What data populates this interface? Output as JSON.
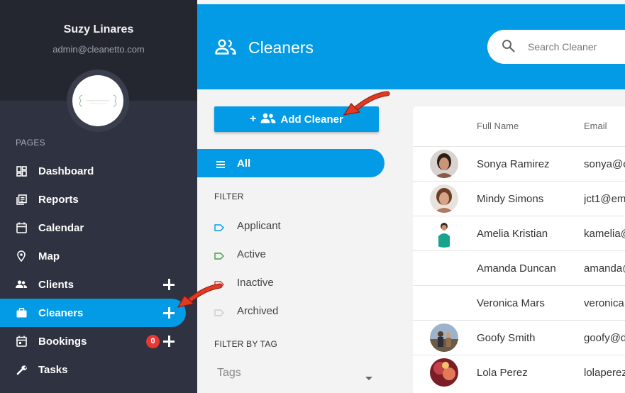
{
  "user": {
    "name": "Suzy Linares",
    "email": "admin@cleanetto.com",
    "logo_text": "Liviana Cleaning"
  },
  "sidebar": {
    "section_label": "PAGES",
    "items": [
      {
        "label": "Dashboard",
        "icon": "dashboard-icon"
      },
      {
        "label": "Reports",
        "icon": "reports-icon"
      },
      {
        "label": "Calendar",
        "icon": "calendar-icon"
      },
      {
        "label": "Map",
        "icon": "map-pin-icon"
      },
      {
        "label": "Clients",
        "icon": "people-icon"
      },
      {
        "label": "Cleaners",
        "icon": "briefcase-icon"
      },
      {
        "label": "Bookings",
        "icon": "calendar-icon",
        "badge": "0"
      },
      {
        "label": "Tasks",
        "icon": "wrench-icon"
      }
    ]
  },
  "header": {
    "title": "Cleaners",
    "search_placeholder": "Search Cleaner"
  },
  "actions": {
    "add_button_label": "Add Cleaner"
  },
  "filters": {
    "all_label": "All",
    "filter_heading": "FILTER",
    "statuses": [
      {
        "label": "Applicant",
        "color": "#039be5"
      },
      {
        "label": "Active",
        "color": "#43a047"
      },
      {
        "label": "Inactive",
        "color": "#e53935"
      },
      {
        "label": "Archived",
        "color": "#cccccc"
      }
    ],
    "tag_heading": "FILTER BY TAG",
    "tags_placeholder": "Tags"
  },
  "table": {
    "columns": [
      "Full Name",
      "Email"
    ],
    "rows": [
      {
        "name": "Sonya Ramirez",
        "email": "sonya@c",
        "has_photo": true
      },
      {
        "name": "Mindy Simons",
        "email": "jct1@em",
        "has_photo": true
      },
      {
        "name": "Amelia Kristian",
        "email": "kamelia@",
        "has_photo": true
      },
      {
        "name": "Amanda Duncan",
        "email": "amanda@",
        "has_photo": false
      },
      {
        "name": "Veronica Mars",
        "email": "veronica@",
        "has_photo": false
      },
      {
        "name": "Goofy Smith",
        "email": "goofy@d",
        "has_photo": true
      },
      {
        "name": "Lola Perez",
        "email": "lolaperez",
        "has_photo": true
      }
    ]
  },
  "colors": {
    "accent": "#039be5",
    "sidebar": "#2f3240",
    "sidebar_top": "#252730",
    "badge": "#e53935",
    "arrow": "#d32f1f"
  }
}
